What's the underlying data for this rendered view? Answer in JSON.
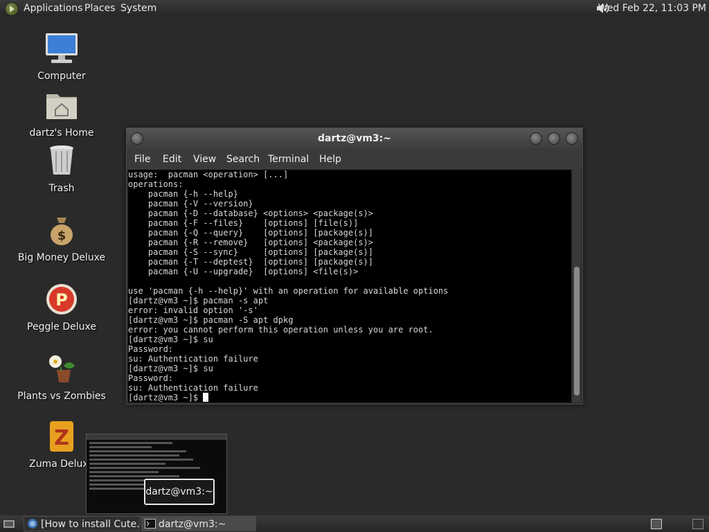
{
  "top_panel": {
    "menus": [
      "Applications",
      "Places",
      "System"
    ],
    "clock": "Wed Feb 22, 11:03 PM",
    "icons": {
      "apps": "applications-icon",
      "volume": "volume-icon"
    }
  },
  "desktop_icons": [
    {
      "label": "Computer",
      "icon": "computer-icon"
    },
    {
      "label": "dartz's Home",
      "icon": "home-folder-icon"
    },
    {
      "label": "Trash",
      "icon": "trash-icon"
    },
    {
      "label": "Big Money Deluxe",
      "icon": "money-bag-icon"
    },
    {
      "label": "Peggle Deluxe",
      "icon": "peggle-icon"
    },
    {
      "label": "Plants vs Zombies",
      "icon": "plants-vs-zombies-icon"
    },
    {
      "label": "Zuma Deluxe",
      "icon": "zuma-icon"
    }
  ],
  "terminal": {
    "title": "dartz@vm3:~",
    "menu": [
      "File",
      "Edit",
      "View",
      "Search",
      "Terminal",
      "Help"
    ],
    "lines": [
      "usage:  pacman <operation> [...]",
      "operations:",
      "    pacman {-h --help}",
      "    pacman {-V --version}",
      "    pacman {-D --database} <options> <package(s)>",
      "    pacman {-F --files}    [options] [file(s)]",
      "    pacman {-Q --query}    [options] [package(s)]",
      "    pacman {-R --remove}   [options] <package(s)>",
      "    pacman {-S --sync}     [options] [package(s)]",
      "    pacman {-T --deptest}  [options] [package(s)]",
      "    pacman {-U --upgrade}  [options] <file(s)>",
      "",
      "use 'pacman {-h --help}' with an operation for available options",
      "[dartz@vm3 ~]$ pacman -s apt",
      "error: invalid option '-s'",
      "[dartz@vm3 ~]$ pacman -S apt dpkg",
      "error: you cannot perform this operation unless you are root.",
      "[dartz@vm3 ~]$ su",
      "Password:",
      "su: Authentication failure",
      "[dartz@vm3 ~]$ su",
      "Password:",
      "su: Authentication failure"
    ],
    "prompt": "[dartz@vm3 ~]$ "
  },
  "preview_tooltip": "dartz@vm3:~",
  "bottom_panel": {
    "tasks": [
      {
        "label": "[How to install Cute...",
        "icon": "browser-icon"
      },
      {
        "label": "dartz@vm3:~",
        "icon": "terminal-icon"
      }
    ]
  }
}
